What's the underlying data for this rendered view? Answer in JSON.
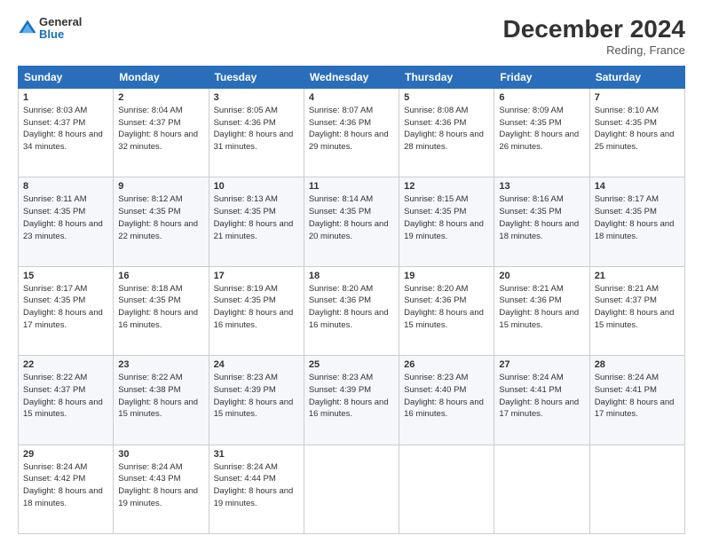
{
  "header": {
    "logo_general": "General",
    "logo_blue": "Blue",
    "month_title": "December 2024",
    "location": "Reding, France"
  },
  "days_of_week": [
    "Sunday",
    "Monday",
    "Tuesday",
    "Wednesday",
    "Thursday",
    "Friday",
    "Saturday"
  ],
  "weeks": [
    [
      {
        "day": "1",
        "sunrise": "Sunrise: 8:03 AM",
        "sunset": "Sunset: 4:37 PM",
        "daylight": "Daylight: 8 hours and 34 minutes."
      },
      {
        "day": "2",
        "sunrise": "Sunrise: 8:04 AM",
        "sunset": "Sunset: 4:37 PM",
        "daylight": "Daylight: 8 hours and 32 minutes."
      },
      {
        "day": "3",
        "sunrise": "Sunrise: 8:05 AM",
        "sunset": "Sunset: 4:36 PM",
        "daylight": "Daylight: 8 hours and 31 minutes."
      },
      {
        "day": "4",
        "sunrise": "Sunrise: 8:07 AM",
        "sunset": "Sunset: 4:36 PM",
        "daylight": "Daylight: 8 hours and 29 minutes."
      },
      {
        "day": "5",
        "sunrise": "Sunrise: 8:08 AM",
        "sunset": "Sunset: 4:36 PM",
        "daylight": "Daylight: 8 hours and 28 minutes."
      },
      {
        "day": "6",
        "sunrise": "Sunrise: 8:09 AM",
        "sunset": "Sunset: 4:35 PM",
        "daylight": "Daylight: 8 hours and 26 minutes."
      },
      {
        "day": "7",
        "sunrise": "Sunrise: 8:10 AM",
        "sunset": "Sunset: 4:35 PM",
        "daylight": "Daylight: 8 hours and 25 minutes."
      }
    ],
    [
      {
        "day": "8",
        "sunrise": "Sunrise: 8:11 AM",
        "sunset": "Sunset: 4:35 PM",
        "daylight": "Daylight: 8 hours and 23 minutes."
      },
      {
        "day": "9",
        "sunrise": "Sunrise: 8:12 AM",
        "sunset": "Sunset: 4:35 PM",
        "daylight": "Daylight: 8 hours and 22 minutes."
      },
      {
        "day": "10",
        "sunrise": "Sunrise: 8:13 AM",
        "sunset": "Sunset: 4:35 PM",
        "daylight": "Daylight: 8 hours and 21 minutes."
      },
      {
        "day": "11",
        "sunrise": "Sunrise: 8:14 AM",
        "sunset": "Sunset: 4:35 PM",
        "daylight": "Daylight: 8 hours and 20 minutes."
      },
      {
        "day": "12",
        "sunrise": "Sunrise: 8:15 AM",
        "sunset": "Sunset: 4:35 PM",
        "daylight": "Daylight: 8 hours and 19 minutes."
      },
      {
        "day": "13",
        "sunrise": "Sunrise: 8:16 AM",
        "sunset": "Sunset: 4:35 PM",
        "daylight": "Daylight: 8 hours and 18 minutes."
      },
      {
        "day": "14",
        "sunrise": "Sunrise: 8:17 AM",
        "sunset": "Sunset: 4:35 PM",
        "daylight": "Daylight: 8 hours and 18 minutes."
      }
    ],
    [
      {
        "day": "15",
        "sunrise": "Sunrise: 8:17 AM",
        "sunset": "Sunset: 4:35 PM",
        "daylight": "Daylight: 8 hours and 17 minutes."
      },
      {
        "day": "16",
        "sunrise": "Sunrise: 8:18 AM",
        "sunset": "Sunset: 4:35 PM",
        "daylight": "Daylight: 8 hours and 16 minutes."
      },
      {
        "day": "17",
        "sunrise": "Sunrise: 8:19 AM",
        "sunset": "Sunset: 4:35 PM",
        "daylight": "Daylight: 8 hours and 16 minutes."
      },
      {
        "day": "18",
        "sunrise": "Sunrise: 8:20 AM",
        "sunset": "Sunset: 4:36 PM",
        "daylight": "Daylight: 8 hours and 16 minutes."
      },
      {
        "day": "19",
        "sunrise": "Sunrise: 8:20 AM",
        "sunset": "Sunset: 4:36 PM",
        "daylight": "Daylight: 8 hours and 15 minutes."
      },
      {
        "day": "20",
        "sunrise": "Sunrise: 8:21 AM",
        "sunset": "Sunset: 4:36 PM",
        "daylight": "Daylight: 8 hours and 15 minutes."
      },
      {
        "day": "21",
        "sunrise": "Sunrise: 8:21 AM",
        "sunset": "Sunset: 4:37 PM",
        "daylight": "Daylight: 8 hours and 15 minutes."
      }
    ],
    [
      {
        "day": "22",
        "sunrise": "Sunrise: 8:22 AM",
        "sunset": "Sunset: 4:37 PM",
        "daylight": "Daylight: 8 hours and 15 minutes."
      },
      {
        "day": "23",
        "sunrise": "Sunrise: 8:22 AM",
        "sunset": "Sunset: 4:38 PM",
        "daylight": "Daylight: 8 hours and 15 minutes."
      },
      {
        "day": "24",
        "sunrise": "Sunrise: 8:23 AM",
        "sunset": "Sunset: 4:39 PM",
        "daylight": "Daylight: 8 hours and 15 minutes."
      },
      {
        "day": "25",
        "sunrise": "Sunrise: 8:23 AM",
        "sunset": "Sunset: 4:39 PM",
        "daylight": "Daylight: 8 hours and 16 minutes."
      },
      {
        "day": "26",
        "sunrise": "Sunrise: 8:23 AM",
        "sunset": "Sunset: 4:40 PM",
        "daylight": "Daylight: 8 hours and 16 minutes."
      },
      {
        "day": "27",
        "sunrise": "Sunrise: 8:24 AM",
        "sunset": "Sunset: 4:41 PM",
        "daylight": "Daylight: 8 hours and 17 minutes."
      },
      {
        "day": "28",
        "sunrise": "Sunrise: 8:24 AM",
        "sunset": "Sunset: 4:41 PM",
        "daylight": "Daylight: 8 hours and 17 minutes."
      }
    ],
    [
      {
        "day": "29",
        "sunrise": "Sunrise: 8:24 AM",
        "sunset": "Sunset: 4:42 PM",
        "daylight": "Daylight: 8 hours and 18 minutes."
      },
      {
        "day": "30",
        "sunrise": "Sunrise: 8:24 AM",
        "sunset": "Sunset: 4:43 PM",
        "daylight": "Daylight: 8 hours and 19 minutes."
      },
      {
        "day": "31",
        "sunrise": "Sunrise: 8:24 AM",
        "sunset": "Sunset: 4:44 PM",
        "daylight": "Daylight: 8 hours and 19 minutes."
      },
      null,
      null,
      null,
      null
    ]
  ]
}
